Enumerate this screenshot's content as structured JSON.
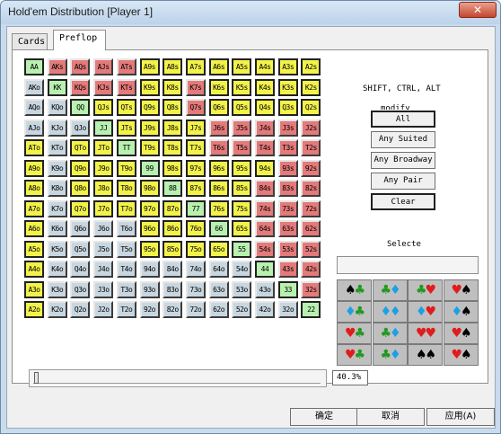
{
  "window": {
    "title": "Hold'em Distribution [Player 1]",
    "close_label": "✕"
  },
  "tabs": [
    {
      "label": "Cards"
    },
    {
      "label": "Preflop"
    }
  ],
  "grid": {
    "rows": [
      [
        "AA",
        "AKs",
        "AQs",
        "AJs",
        "ATs",
        "A9s",
        "A8s",
        "A7s",
        "A6s",
        "A5s",
        "A4s",
        "A3s",
        "A2s"
      ],
      [
        "AKo",
        "KK",
        "KQs",
        "KJs",
        "KTs",
        "K9s",
        "K8s",
        "K7s",
        "K6s",
        "K5s",
        "K4s",
        "K3s",
        "K2s"
      ],
      [
        "AQo",
        "KQo",
        "QQ",
        "QJs",
        "QTs",
        "Q9s",
        "Q8s",
        "Q7s",
        "Q6s",
        "Q5s",
        "Q4s",
        "Q3s",
        "Q2s"
      ],
      [
        "AJo",
        "KJo",
        "QJo",
        "JJ",
        "JTs",
        "J9s",
        "J8s",
        "J7s",
        "J6s",
        "J5s",
        "J4s",
        "J3s",
        "J2s"
      ],
      [
        "ATo",
        "KTo",
        "QTo",
        "JTo",
        "TT",
        "T9s",
        "T8s",
        "T7s",
        "T6s",
        "T5s",
        "T4s",
        "T3s",
        "T2s"
      ],
      [
        "A9o",
        "K9o",
        "Q9o",
        "J9o",
        "T9o",
        "99",
        "98s",
        "97s",
        "96s",
        "95s",
        "94s",
        "93s",
        "92s"
      ],
      [
        "A8o",
        "K8o",
        "Q8o",
        "J8o",
        "T8o",
        "98o",
        "88",
        "87s",
        "86s",
        "85s",
        "84s",
        "83s",
        "82s"
      ],
      [
        "A7o",
        "K7o",
        "Q7o",
        "J7o",
        "T7o",
        "97o",
        "87o",
        "77",
        "76s",
        "75s",
        "74s",
        "73s",
        "72s"
      ],
      [
        "A6o",
        "K6o",
        "Q6o",
        "J6o",
        "T6o",
        "96o",
        "86o",
        "76o",
        "66",
        "65s",
        "64s",
        "63s",
        "62s"
      ],
      [
        "A5o",
        "K5o",
        "Q5o",
        "J5o",
        "T5o",
        "95o",
        "85o",
        "75o",
        "65o",
        "55",
        "54s",
        "53s",
        "52s"
      ],
      [
        "A4o",
        "K4o",
        "Q4o",
        "J4o",
        "T4o",
        "94o",
        "84o",
        "74o",
        "64o",
        "54o",
        "44",
        "43s",
        "42s"
      ],
      [
        "A3o",
        "K3o",
        "Q3o",
        "J3o",
        "T3o",
        "93o",
        "83o",
        "73o",
        "63o",
        "53o",
        "43o",
        "33",
        "32s"
      ],
      [
        "A2o",
        "K2o",
        "Q2o",
        "J2o",
        "T2o",
        "92o",
        "82o",
        "72o",
        "62o",
        "52o",
        "42o",
        "32o",
        "22"
      ]
    ],
    "colors": {
      "pair": "#b8f0b0",
      "suited_selected": "#f2f24a",
      "suited_unselected": "#e47a7a",
      "offsuit_unselected": "#c8d6e0"
    }
  },
  "right_panel": {
    "modifier_label": "SHIFT, CTRL, ALT",
    "modifier_label2": "modify",
    "buttons": [
      "All",
      "Any Suited",
      "Any Broadway",
      "Any Pair",
      "Clear"
    ],
    "selected_label": "Selecte"
  },
  "suits_grid": [
    [
      "spade",
      "club",
      "club",
      "diamond",
      "club",
      "heart",
      "heart",
      "spade"
    ],
    [
      "diamond",
      "club",
      "diamond",
      "diamond",
      "diamond",
      "heart",
      "diamond",
      "spade"
    ],
    [
      "heart",
      "club",
      "club",
      "diamond",
      "heart",
      "heart",
      "heart",
      "spade"
    ],
    [
      "heart",
      "club",
      "club",
      "diamond",
      "spade",
      "spade",
      "heart",
      "spade"
    ]
  ],
  "slider": {
    "percent_text": "40.3%",
    "value": 0.403
  },
  "bottom_buttons": {
    "ok": "确定",
    "cancel": "取消",
    "apply": "应用(A)"
  }
}
